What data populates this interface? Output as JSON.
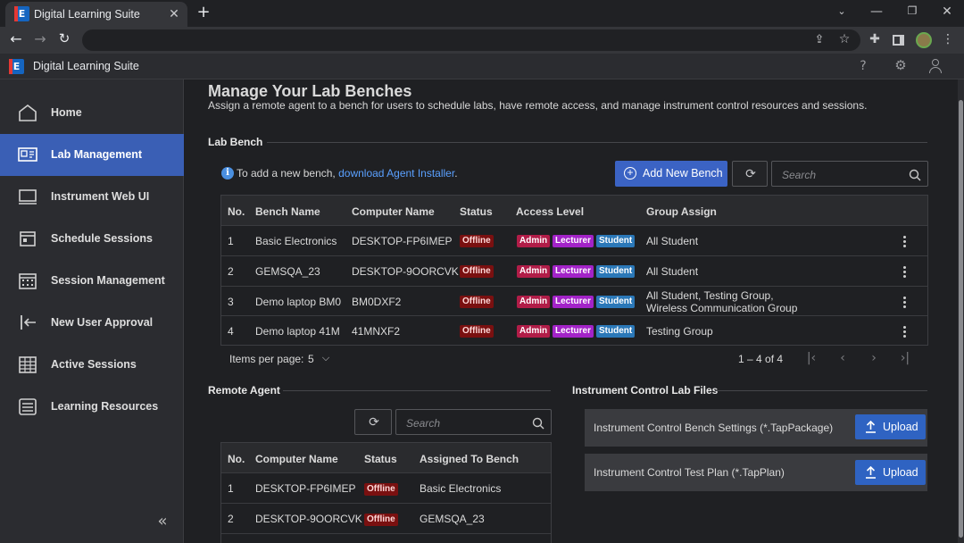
{
  "browser": {
    "tab_title": "Digital Learning Suite",
    "new_tab": "+",
    "window_controls": [
      "chevron-down-icon",
      "minimize-icon",
      "restore-icon",
      "close-icon"
    ]
  },
  "app": {
    "title": "Digital Learning Suite",
    "logo_text": "E"
  },
  "sidebar": {
    "items": [
      {
        "label": "Home",
        "icon": "home-icon"
      },
      {
        "label": "Lab Management",
        "icon": "lab-icon",
        "active": true
      },
      {
        "label": "Instrument Web UI",
        "icon": "monitor-icon"
      },
      {
        "label": "Schedule Sessions",
        "icon": "calendar-icon"
      },
      {
        "label": "Session Management",
        "icon": "calendar-grid-icon"
      },
      {
        "label": "New User Approval",
        "icon": "login-icon"
      },
      {
        "label": "Active Sessions",
        "icon": "table-icon"
      },
      {
        "label": "Learning Resources",
        "icon": "list-icon"
      }
    ],
    "collapse": "«"
  },
  "page": {
    "title": "Manage Your Lab Benches",
    "subtitle": "Assign a remote agent to a bench for users to schedule labs, have remote access, and manage instrument control resources and sessions."
  },
  "lab_bench": {
    "section_title": "Lab Bench",
    "info_text": "To add a new bench,",
    "info_link": "download Agent Installer",
    "info_end": ".",
    "add_button": "Add New Bench",
    "search_placeholder": "Search",
    "columns": [
      "No.",
      "Bench Name",
      "Computer Name",
      "Status",
      "Access Level",
      "Group Assign"
    ],
    "rows": [
      {
        "no": "1",
        "bench": "Basic Electronics",
        "computer": "DESKTOP-FP6IMEP",
        "status": "Offline",
        "access": [
          "Admin",
          "Lecturer",
          "Student"
        ],
        "group": [
          "All Student"
        ]
      },
      {
        "no": "2",
        "bench": "GEMSQA_23",
        "computer": "DESKTOP-9OORCVK",
        "status": "Offline",
        "access": [
          "Admin",
          "Lecturer",
          "Student"
        ],
        "group": [
          "All Student"
        ]
      },
      {
        "no": "3",
        "bench": "Demo laptop BM0",
        "computer": "BM0DXF2",
        "status": "Offline",
        "access": [
          "Admin",
          "Lecturer",
          "Student"
        ],
        "group": [
          "All Student, Testing Group,",
          "Wireless Communication Group"
        ]
      },
      {
        "no": "4",
        "bench": "Demo laptop 41M",
        "computer": "41MNXF2",
        "status": "Offline",
        "access": [
          "Admin",
          "Lecturer",
          "Student"
        ],
        "group": [
          "Testing Group"
        ]
      }
    ],
    "items_per_page_label": "Items per page:",
    "items_per_page": "5",
    "range": "1 – 4 of 4"
  },
  "remote_agent": {
    "section_title": "Remote Agent",
    "search_placeholder": "Search",
    "columns": [
      "No.",
      "Computer Name",
      "Status",
      "Assigned To Bench"
    ],
    "rows": [
      {
        "no": "1",
        "computer": "DESKTOP-FP6IMEP",
        "status": "Offline",
        "bench": "Basic Electronics"
      },
      {
        "no": "2",
        "computer": "DESKTOP-9OORCVK",
        "status": "Offline",
        "bench": "GEMSQA_23"
      }
    ]
  },
  "instrument_files": {
    "section_title": "Instrument Control Lab Files",
    "items": [
      {
        "label": "Instrument Control Bench Settings (*.TapPackage)",
        "button": "Upload"
      },
      {
        "label": "Instrument Control Test Plan (*.TapPlan)",
        "button": "Upload"
      }
    ]
  },
  "colors": {
    "accent": "#3b63c4",
    "offline": "#7a1010",
    "admin": "#b11d48",
    "lecturer": "#a323c8",
    "student": "#2b78b8"
  }
}
